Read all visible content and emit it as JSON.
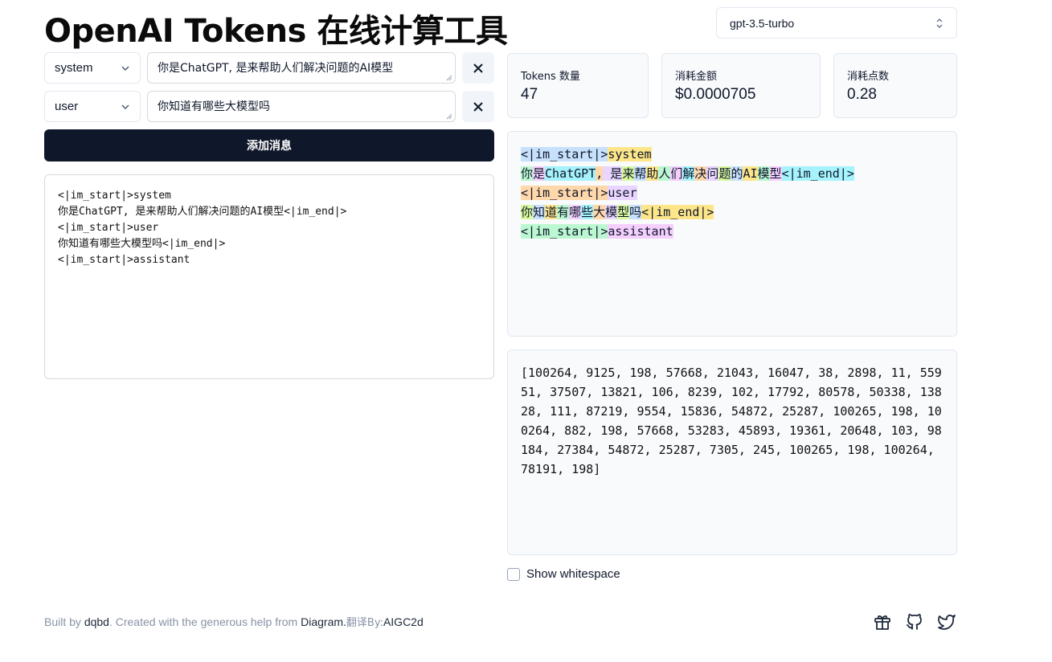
{
  "header": {
    "title": "OpenAI Tokens 在线计算工具",
    "model_selected": "gpt-3.5-turbo"
  },
  "messages": [
    {
      "role": "system",
      "content": "你是ChatGPT, 是来帮助人们解决问题的AI模型"
    },
    {
      "role": "user",
      "content": "你知道有哪些大模型吗"
    }
  ],
  "add_button_label": "添加消息",
  "prompt_preview": "<|im_start|>system\n你是ChatGPT, 是来帮助人们解决问题的AI模型<|im_end|>\n<|im_start|>user\n你知道有哪些大模型吗<|im_end|>\n<|im_start|>assistant",
  "stats": [
    {
      "label": "Tokens 数量",
      "value": "47"
    },
    {
      "label": "消耗金额",
      "value": "$0.0000705"
    },
    {
      "label": "消耗点数",
      "value": "0.28"
    }
  ],
  "token_palette": [
    "#c7e0fb",
    "#fde68a",
    "#bbf7d0",
    "#f5d0fe",
    "#a5f3fc",
    "#fed7aa",
    "#e9d5ff",
    "#d9f99d"
  ],
  "token_lines": [
    [
      "<|im_start|>",
      "system"
    ],
    [
      "你",
      "是",
      "ChatGPT",
      ",",
      " 是",
      "来",
      "帮",
      "助",
      "人",
      "们",
      "解",
      "决",
      "问",
      "题",
      "的",
      "AI",
      "模",
      "型",
      "<|im_end|>"
    ],
    [
      "<|im_start|>",
      "user"
    ],
    [
      "你",
      "知",
      "道",
      "有",
      "哪",
      "些",
      "大",
      "模",
      "型",
      "吗",
      "<|im_end|>"
    ],
    [
      "<|im_start|>",
      "assistant"
    ]
  ],
  "token_ids": "[100264, 9125, 198, 57668, 21043, 16047, 38, 2898, 11, 55951, 37507, 13821, 106, 8239, 102, 17792, 80578, 50338, 13828, 111, 87219, 9554, 15836, 54872, 25287, 100265, 198, 100264, 882, 198, 57668, 53283, 45893, 19361, 20648, 103, 98184, 27384, 54872, 25287, 7305, 245, 100265, 198, 100264, 78191, 198]",
  "show_whitespace_label": "Show whitespace",
  "footer": {
    "built_by": "Built by",
    "author": "dqbd",
    "created_with": ". Created with the generous help from",
    "diagram": "Diagram.",
    "translated_by": "翻译By:",
    "translator": "AIGC2d"
  },
  "footer_icons": [
    "gift-icon",
    "github-icon",
    "twitter-icon"
  ]
}
